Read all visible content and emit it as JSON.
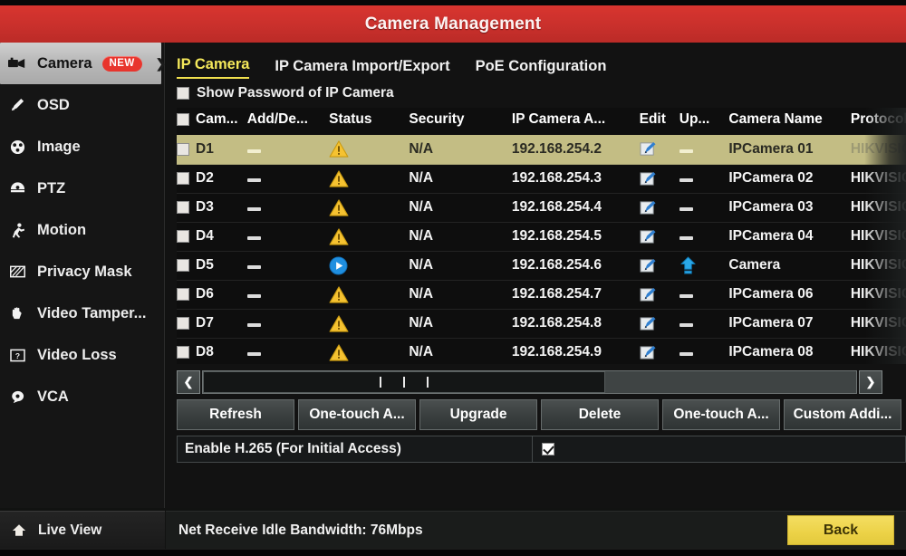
{
  "window": {
    "title": "Camera Management"
  },
  "sidebar": {
    "items": [
      {
        "label": "Camera",
        "icon": "camera-icon",
        "badge": "NEW",
        "chevron": "❯",
        "active": true
      },
      {
        "label": "OSD",
        "icon": "osd-pen-icon",
        "badge": "",
        "chevron": "",
        "active": false
      },
      {
        "label": "Image",
        "icon": "image-icon",
        "badge": "",
        "chevron": "",
        "active": false
      },
      {
        "label": "PTZ",
        "icon": "ptz-dome-icon",
        "badge": "",
        "chevron": "",
        "active": false
      },
      {
        "label": "Motion",
        "icon": "motion-person-icon",
        "badge": "",
        "chevron": "",
        "active": false
      },
      {
        "label": "Privacy Mask",
        "icon": "privacy-mask-icon",
        "badge": "",
        "chevron": "",
        "active": false
      },
      {
        "label": "Video Tamper...",
        "icon": "hand-icon",
        "badge": "",
        "chevron": "",
        "active": false
      },
      {
        "label": "Video Loss",
        "icon": "video-loss-icon",
        "badge": "",
        "chevron": "",
        "active": false
      },
      {
        "label": "VCA",
        "icon": "vca-icon",
        "badge": "",
        "chevron": "",
        "active": false
      }
    ],
    "live_view": {
      "label": "Live View",
      "icon": "home-icon"
    }
  },
  "tabs": [
    {
      "label": "IP Camera",
      "selected": true
    },
    {
      "label": "IP Camera Import/Export",
      "selected": false
    },
    {
      "label": "PoE Configuration",
      "selected": false
    }
  ],
  "show_password": {
    "label": "Show Password of IP Camera",
    "checked": false
  },
  "table": {
    "columns": [
      "Cam...",
      "Add/De...",
      "Status",
      "Security",
      "IP Camera A...",
      "Edit",
      "Up...",
      "Camera Name",
      "Protocol"
    ],
    "header_checkbox_checked": false,
    "rows": [
      {
        "checked": false,
        "cam": "D1",
        "add_delete": "dash",
        "status": "warning",
        "security": "N/A",
        "ip": "192.168.254.2",
        "edit": "edit-icon",
        "upgrade": "dash",
        "name": "IPCamera 01",
        "protocol": "HIKVISIO",
        "selected": true
      },
      {
        "checked": false,
        "cam": "D2",
        "add_delete": "dash",
        "status": "warning",
        "security": "N/A",
        "ip": "192.168.254.3",
        "edit": "edit-icon",
        "upgrade": "dash",
        "name": "IPCamera 02",
        "protocol": "HIKVISIO",
        "selected": false
      },
      {
        "checked": false,
        "cam": "D3",
        "add_delete": "dash",
        "status": "warning",
        "security": "N/A",
        "ip": "192.168.254.4",
        "edit": "edit-icon",
        "upgrade": "dash",
        "name": "IPCamera 03",
        "protocol": "HIKVISIO",
        "selected": false
      },
      {
        "checked": false,
        "cam": "D4",
        "add_delete": "dash",
        "status": "warning",
        "security": "N/A",
        "ip": "192.168.254.5",
        "edit": "edit-icon",
        "upgrade": "dash",
        "name": "IPCamera 04",
        "protocol": "HIKVISIO",
        "selected": false
      },
      {
        "checked": false,
        "cam": "D5",
        "add_delete": "dash",
        "status": "connected",
        "security": "N/A",
        "ip": "192.168.254.6",
        "edit": "edit-icon",
        "upgrade": "up-arrow",
        "name": "Camera",
        "protocol": "HIKVISIO",
        "selected": false
      },
      {
        "checked": false,
        "cam": "D6",
        "add_delete": "dash",
        "status": "warning",
        "security": "N/A",
        "ip": "192.168.254.7",
        "edit": "edit-icon",
        "upgrade": "dash",
        "name": "IPCamera 06",
        "protocol": "HIKVISIO",
        "selected": false
      },
      {
        "checked": false,
        "cam": "D7",
        "add_delete": "dash",
        "status": "warning",
        "security": "N/A",
        "ip": "192.168.254.8",
        "edit": "edit-icon",
        "upgrade": "dash",
        "name": "IPCamera 07",
        "protocol": "HIKVISIO",
        "selected": false
      },
      {
        "checked": false,
        "cam": "D8",
        "add_delete": "dash",
        "status": "warning",
        "security": "N/A",
        "ip": "192.168.254.9",
        "edit": "edit-icon",
        "upgrade": "dash",
        "name": "IPCamera 08",
        "protocol": "HIKVISIO",
        "selected": false
      }
    ]
  },
  "scrollbar": {
    "left_arrow": "❮",
    "right_arrow": "❯"
  },
  "buttons": [
    {
      "label": "Refresh"
    },
    {
      "label": "One-touch A..."
    },
    {
      "label": "Upgrade"
    },
    {
      "label": "Delete"
    },
    {
      "label": "One-touch A..."
    },
    {
      "label": "Custom Addi..."
    }
  ],
  "h265": {
    "label": "Enable H.265 (For Initial Access)",
    "checked": true
  },
  "footer": {
    "status": "Net Receive Idle Bandwidth: 76Mbps",
    "back_label": "Back"
  },
  "colors": {
    "title_red": "#c9302c",
    "tab_yellow": "#f4e85a",
    "row_selected": "#c3bd84",
    "warning_yellow": "#f5c231",
    "status_blue": "#1f8fe0",
    "back_yellow": "#ecd247",
    "badge_red": "#e8352d"
  }
}
